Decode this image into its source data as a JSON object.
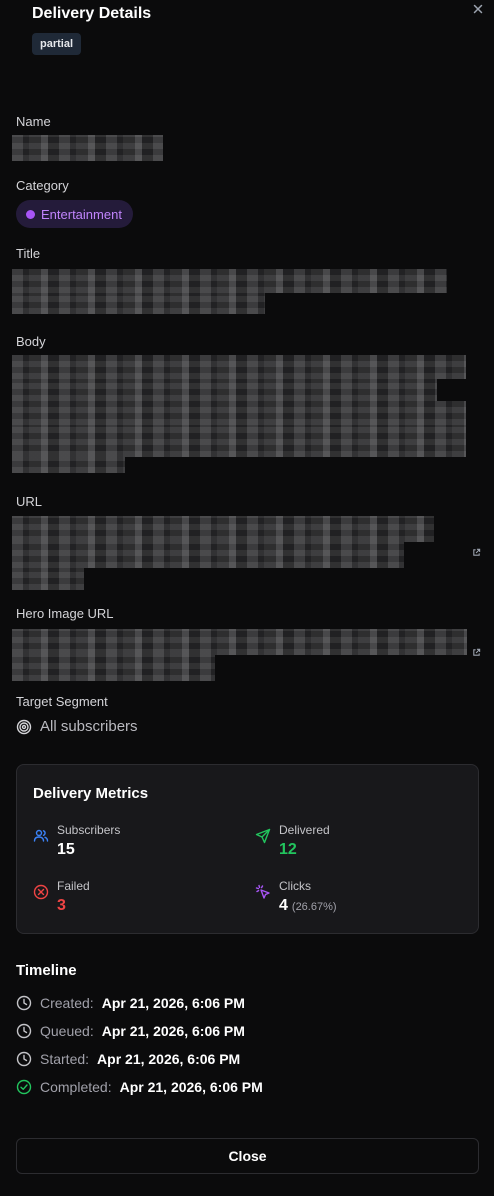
{
  "header": {
    "title": "Delivery Details",
    "status_badge": "partial",
    "close_icon": "close-icon"
  },
  "fields": {
    "name_label": "Name",
    "category_label": "Category",
    "category_value": "Entertainment",
    "category_color": "#a855f7",
    "title_label": "Title",
    "body_label": "Body",
    "url_label": "URL",
    "hero_label": "Hero Image URL",
    "target_label": "Target Segment",
    "target_value": "All subscribers",
    "target_icon": "target-icon"
  },
  "metrics": {
    "title": "Delivery Metrics",
    "subscribers": {
      "label": "Subscribers",
      "value": "15",
      "icon": "users-icon",
      "color": "#3b82f6"
    },
    "delivered": {
      "label": "Delivered",
      "value": "12",
      "icon": "send-icon",
      "color": "#22c55e"
    },
    "failed": {
      "label": "Failed",
      "value": "3",
      "icon": "x-circle-icon",
      "color": "#ef4444"
    },
    "clicks": {
      "label": "Clicks",
      "value": "4",
      "sub": "(26.67%)",
      "icon": "pointer-click-icon",
      "color": "#a855f7"
    }
  },
  "timeline": {
    "title": "Timeline",
    "items": [
      {
        "label": "Created:",
        "value": "Apr 21, 2026, 6:06 PM",
        "icon": "clock-icon"
      },
      {
        "label": "Queued:",
        "value": "Apr 21, 2026, 6:06 PM",
        "icon": "clock-icon"
      },
      {
        "label": "Started:",
        "value": "Apr 21, 2026, 6:06 PM",
        "icon": "clock-icon"
      },
      {
        "label": "Completed:",
        "value": "Apr 21, 2026, 6:06 PM",
        "icon": "check-circle-icon"
      }
    ]
  },
  "footer": {
    "close_label": "Close"
  }
}
